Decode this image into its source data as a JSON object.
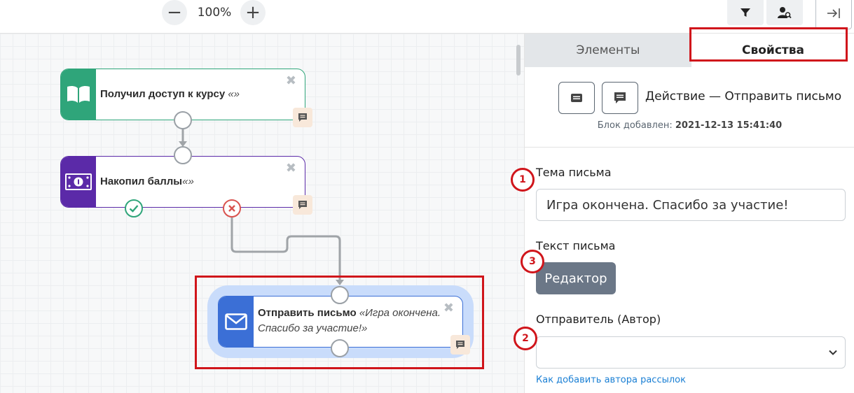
{
  "toolbar": {
    "zoom_out": "−",
    "zoom_level": "100%",
    "zoom_in": "+",
    "filter_icon": "filter-icon",
    "user_search_icon": "user-search-icon",
    "collapse_icon": "collapse-panel-icon"
  },
  "canvas": {
    "nodes": [
      {
        "title": "Получил доступ к курсу",
        "detail": "«»",
        "icon": "book-icon",
        "color": "#2fa57a"
      },
      {
        "title": "Накопил баллы",
        "detail": "«»",
        "icon": "money-icon",
        "color": "#5b2aa8"
      },
      {
        "title": "Отправить письмо",
        "detail": "«Игра окончена.",
        "detail2": "Спасибо за участие!»",
        "icon": "envelope-icon",
        "color": "#3b6fd6"
      }
    ],
    "close_glyph": "✖"
  },
  "panel": {
    "tabs": [
      {
        "label": "Элементы"
      },
      {
        "label": "Свойства"
      }
    ],
    "action_title": "Действие — Отправить письмо",
    "added_label": "Блок добавлен:",
    "added_value": "2021-12-13 15:41:40",
    "subject_label": "Тема письма",
    "subject_value": "Игра окончена. Спасибо за участие!",
    "body_label": "Текст письма",
    "editor_button": "Редактор",
    "author_label": "Отправитель (Автор)",
    "author_value": "",
    "help_link": "Как добавить автора рассылок"
  },
  "annotations": [
    "1",
    "2",
    "3"
  ],
  "colors": {
    "accent_red": "#d0151b",
    "link": "#1a7fd4",
    "editor_button": "#6b7787"
  }
}
